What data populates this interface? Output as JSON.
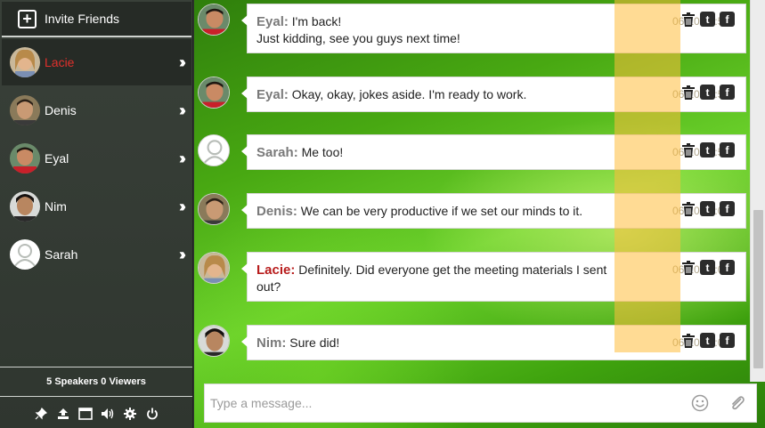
{
  "sidebar": {
    "invite_label": "Invite Friends",
    "users": [
      {
        "name": "Lacie",
        "icon": "female-avatar"
      },
      {
        "name": "Denis",
        "icon": "male-avatar"
      },
      {
        "name": "Eyal",
        "icon": "male-avatar"
      },
      {
        "name": "Nim",
        "icon": "male-avatar"
      },
      {
        "name": "Sarah",
        "icon": "default-avatar"
      }
    ],
    "speakers_text": "5 Speakers 0 Viewers",
    "toolbar_icons": [
      "pin-icon",
      "upload-icon",
      "window-icon",
      "volume-icon",
      "gear-icon",
      "power-icon"
    ]
  },
  "messages": [
    {
      "sender": "Eyal:",
      "text": "I'm back!",
      "text2": "Just kidding, see you guys next time!",
      "time": "06-10 18:50"
    },
    {
      "sender": "Eyal:",
      "text": "Okay, okay, jokes aside. I'm ready to work.",
      "time": "06-10 18:59"
    },
    {
      "sender": "Sarah:",
      "text": "Me too!",
      "time": "06-10 18:59"
    },
    {
      "sender": "Denis:",
      "text": "We can be very productive if we set our minds to it.",
      "time": "06-10 19:00"
    },
    {
      "sender": "Lacie:",
      "text": "Definitely. Did everyone get the meeting materials I sent",
      "text2": "out?",
      "time": "06-10 19:00"
    },
    {
      "sender": "Nim:",
      "text": "Sure did!",
      "time": "06-10 19:02"
    }
  ],
  "composer": {
    "placeholder": "Type a message..."
  },
  "colors": {
    "active_user": "#e0302c",
    "lacie_sender": "#b81d1d",
    "highlight": "#ffbe3c"
  }
}
